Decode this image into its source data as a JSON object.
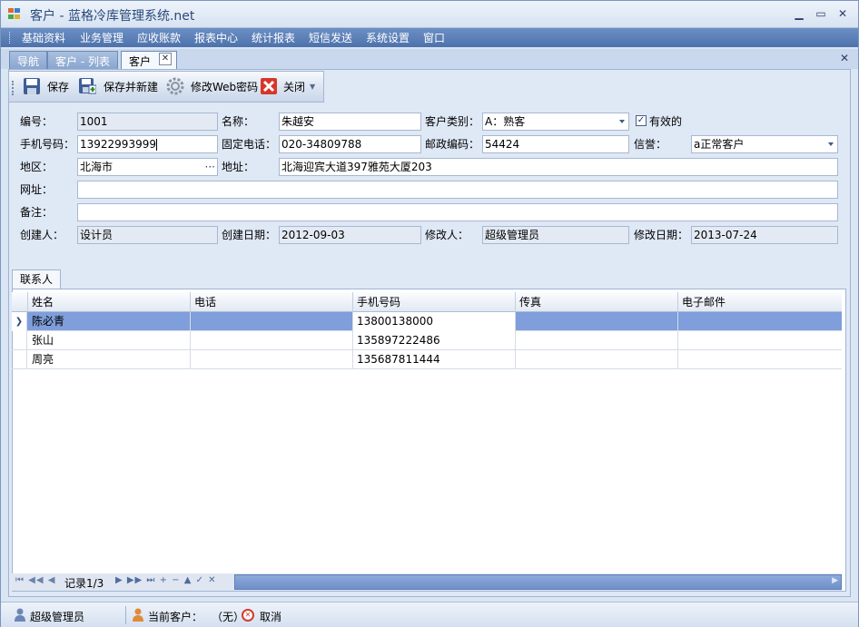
{
  "window": {
    "title": "客户 - 蓝格冷库管理系统.net"
  },
  "menu": [
    {
      "label": "基础资料"
    },
    {
      "label": "业务管理"
    },
    {
      "label": "应收账款"
    },
    {
      "label": "报表中心"
    },
    {
      "label": "统计报表"
    },
    {
      "label": "短信发送"
    },
    {
      "label": "系统设置"
    },
    {
      "label": "窗口"
    }
  ],
  "tabs": [
    {
      "label": "导航"
    },
    {
      "label": "客户 - 列表"
    },
    {
      "label": "客户"
    }
  ],
  "toolbar": {
    "save": "保存",
    "save_new": "保存并新建",
    "change_web_password": "修改Web密码",
    "close": "关闭"
  },
  "form": {
    "code_label": "编号：",
    "code": "1001",
    "name_label": "名称：",
    "name": "朱越安",
    "category_label": "客户类别：",
    "category": "A：熟客",
    "valid_label": "有效的",
    "valid": true,
    "mobile_label": "手机号码：",
    "mobile": "13922993999",
    "phone_label": "固定电话：",
    "phone": "020-34809788",
    "postcode_label": "邮政编码：",
    "postcode": "54424",
    "credit_label": "信誉：",
    "credit": "a正常客户",
    "region_label": "地区：",
    "region": "北海市",
    "address_label": "地址：",
    "address": "北海迎宾大道397雅苑大厦203",
    "website_label": "网址：",
    "website": "",
    "remark_label": "备注：",
    "remark": "",
    "creator_label": "创建人：",
    "creator": "设计员",
    "created_label": "创建日期：",
    "created": "2012-09-03",
    "modifier_label": "修改人：",
    "modifier": "超级管理员",
    "modified_label": "修改日期：",
    "modified": "2013-07-24"
  },
  "contacts": {
    "tab_label": "联系人",
    "columns": [
      "姓名",
      "电话",
      "手机号码",
      "传真",
      "电子邮件"
    ],
    "rows": [
      [
        "陈必青",
        "",
        "13800138000",
        "",
        ""
      ],
      [
        "张山",
        "",
        "135897222486",
        "",
        ""
      ],
      [
        "周亮",
        "",
        "135687811444",
        "",
        ""
      ]
    ],
    "navigator_text": "记录1/3"
  },
  "status": {
    "user": "超级管理员",
    "current_customer_label": "当前客户：",
    "current_customer": "（无）",
    "cancel": "取消"
  }
}
